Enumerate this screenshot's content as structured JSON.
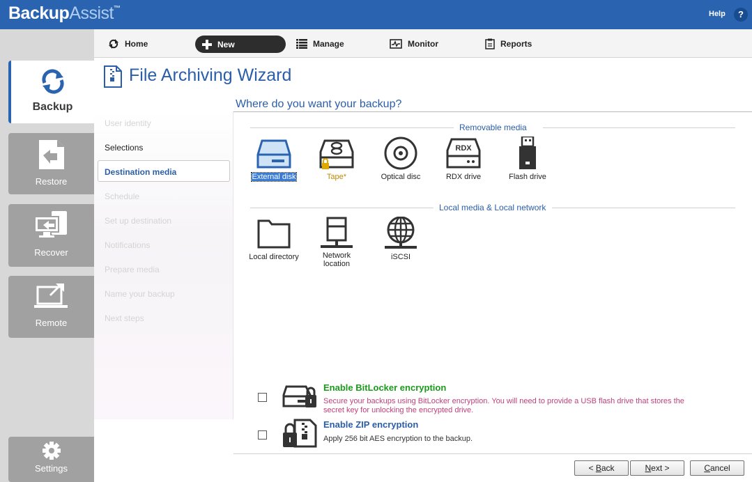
{
  "brand": {
    "part1": "Backup",
    "part2": "Assist",
    "tm": "™"
  },
  "header": {
    "help_label": "Help",
    "help_icon": "?"
  },
  "nav": {
    "backup": "Backup",
    "restore": "Restore",
    "recover": "Recover",
    "remote": "Remote",
    "settings": "Settings"
  },
  "menu": {
    "home": "Home",
    "new": "New",
    "manage": "Manage",
    "monitor": "Monitor",
    "reports": "Reports"
  },
  "wizard": {
    "title": "File Archiving Wizard",
    "question": "Where do you want your backup?"
  },
  "steps": [
    "User identity",
    "Selections",
    "Destination media",
    "Schedule",
    "Set up destination",
    "Notifications",
    "Prepare media",
    "Name your backup",
    "Next steps"
  ],
  "sections": {
    "removable": "Removable media",
    "local": "Local media & Local network"
  },
  "removable_media": [
    "External disk",
    "Tape*",
    "Optical disc",
    "RDX drive",
    "Flash drive"
  ],
  "local_media": [
    "Local directory",
    "Network location",
    "iSCSI"
  ],
  "rdx_icon_text": "RDX",
  "encryption": {
    "bitlocker_title": "Enable BitLocker encryption",
    "bitlocker_desc_1": "Secure your backups using BitLocker encryption. You will need to provide a USB flash drive that stores the",
    "bitlocker_desc_2": "secret key for unlocking the encrypted drive.",
    "zip_title": "Enable ZIP encryption",
    "zip_desc": "Apply 256 bit AES encryption to the backup."
  },
  "buttons": {
    "back_prefix": "< ",
    "back_key": "B",
    "back_rest": "ack",
    "next_key": "N",
    "next_rest": "ext >",
    "cancel_key": "C",
    "cancel_rest": "ancel"
  },
  "colors": {
    "header_bg": "#2a64b0",
    "accent": "#2a5ea8",
    "bitlocker_title": "#1a9a1a",
    "bitlocker_desc": "#c0407a",
    "tape_label": "#c08a00"
  }
}
